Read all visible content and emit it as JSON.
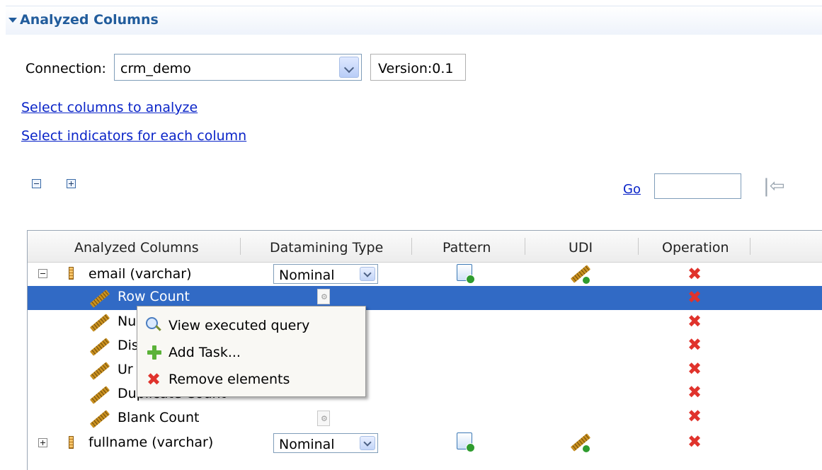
{
  "section": {
    "title": "Analyzed Columns"
  },
  "connection": {
    "label": "Connection:",
    "value": "crm_demo",
    "version": "Version:0.1"
  },
  "links": {
    "select_columns": "Select columns to analyze",
    "select_indicators": "Select indicators for each column"
  },
  "go": {
    "label": "Go",
    "input_value": ""
  },
  "table": {
    "headers": [
      "Analyzed Columns",
      "Datamining Type",
      "Pattern",
      "UDI",
      "Operation"
    ],
    "rows": [
      {
        "label": "email (varchar)",
        "type": "Nominal"
      },
      {
        "label": "Row Count"
      },
      {
        "label": "Nu"
      },
      {
        "label": "Dis"
      },
      {
        "label": "Ur"
      },
      {
        "label": "Duplicate Count"
      },
      {
        "label": "Blank Count"
      },
      {
        "label": "fullname (varchar)",
        "type": "Nominal"
      }
    ]
  },
  "context_menu": {
    "items": [
      "View executed query",
      "Add Task...",
      "Remove elements"
    ]
  },
  "colors": {
    "selection": "#316ac5",
    "header_text": "#215c9c",
    "link": "#0a24c8",
    "delete": "#e0332c"
  }
}
